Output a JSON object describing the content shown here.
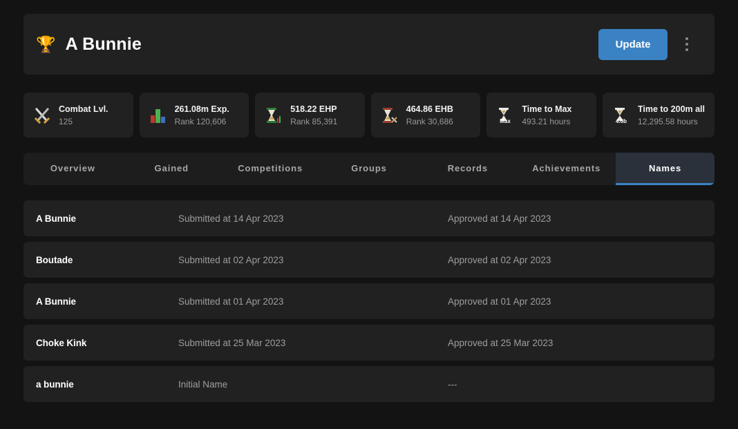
{
  "header": {
    "icon": "trophy-icon",
    "trophy_glyph": "🏆",
    "player_name": "A Bunnie",
    "update_label": "Update",
    "menu_icon": "kebab-menu-icon",
    "accent_color": "#3b82c4"
  },
  "stats": [
    {
      "icon": "crossed-swords-icon",
      "label": "Combat Lvl.",
      "value": "125"
    },
    {
      "icon": "bar-chart-icon",
      "label": "261.08m Exp.",
      "value": "Rank 120,606"
    },
    {
      "icon": "hourglass-green-icon",
      "label": "518.22 EHP",
      "value": "Rank 85,391"
    },
    {
      "icon": "hourglass-red-icon",
      "label": "464.86 EHB",
      "value": "Rank 30,686"
    },
    {
      "icon": "hourglass-max-icon",
      "label": "Time to Max",
      "value": "493.21 hours"
    },
    {
      "icon": "hourglass-4-6b-icon",
      "label": "Time to 200m all",
      "value": "12,295.58 hours"
    }
  ],
  "tabs": [
    {
      "label": "Overview",
      "active": false
    },
    {
      "label": "Gained",
      "active": false
    },
    {
      "label": "Competitions",
      "active": false
    },
    {
      "label": "Groups",
      "active": false
    },
    {
      "label": "Records",
      "active": false
    },
    {
      "label": "Achievements",
      "active": false
    },
    {
      "label": "Names",
      "active": true
    }
  ],
  "names": [
    {
      "name": "A Bunnie",
      "submitted": "Submitted at 14 Apr 2023",
      "approved": "Approved at 14 Apr 2023"
    },
    {
      "name": "Boutade",
      "submitted": "Submitted at 02 Apr 2023",
      "approved": "Approved at 02 Apr 2023"
    },
    {
      "name": "A Bunnie",
      "submitted": "Submitted at 01 Apr 2023",
      "approved": "Approved at 01 Apr 2023"
    },
    {
      "name": "Choke Kink",
      "submitted": "Submitted at 25 Mar 2023",
      "approved": "Approved at 25 Mar 2023"
    },
    {
      "name": "a bunnie",
      "submitted": "Initial Name",
      "approved": "---"
    }
  ]
}
